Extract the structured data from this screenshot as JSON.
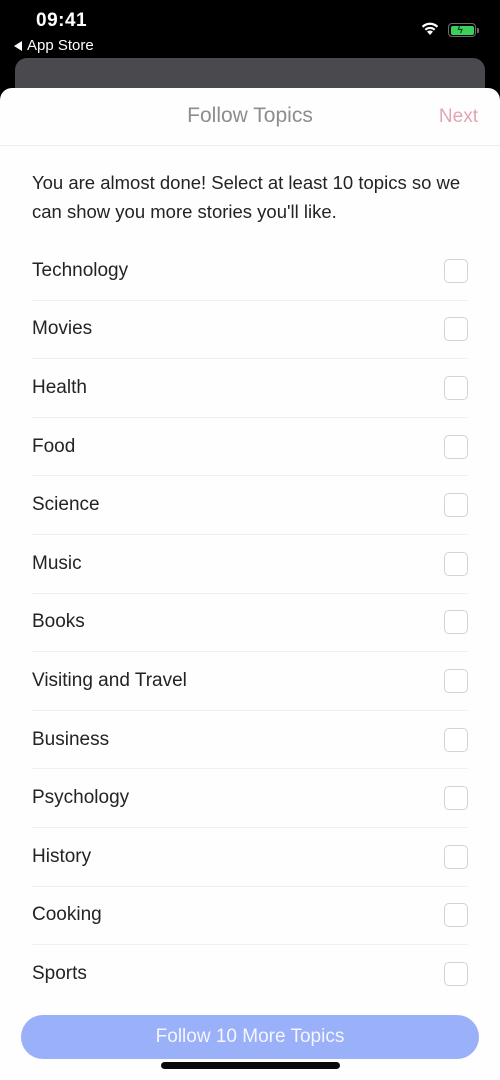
{
  "status_bar": {
    "time": "09:41",
    "back_app_label": "App Store",
    "icons": [
      "wifi-icon",
      "battery-charging-icon"
    ],
    "battery_color": "#3ad05b"
  },
  "nav": {
    "title": "Follow Topics",
    "next_label": "Next",
    "next_color": "#e2a5b3"
  },
  "intro_text": "You are almost done! Select at least 10 topics so we can show you more stories you'll like.",
  "topics": [
    {
      "label": "Technology",
      "checked": false
    },
    {
      "label": "Movies",
      "checked": false
    },
    {
      "label": "Health",
      "checked": false
    },
    {
      "label": "Food",
      "checked": false
    },
    {
      "label": "Science",
      "checked": false
    },
    {
      "label": "Music",
      "checked": false
    },
    {
      "label": "Books",
      "checked": false
    },
    {
      "label": "Visiting and Travel",
      "checked": false
    },
    {
      "label": "Business",
      "checked": false
    },
    {
      "label": "Psychology",
      "checked": false
    },
    {
      "label": "History",
      "checked": false
    },
    {
      "label": "Cooking",
      "checked": false
    },
    {
      "label": "Sports",
      "checked": false
    }
  ],
  "follow_button": {
    "label": "Follow 10 More Topics",
    "color": "#9ab0f8"
  }
}
